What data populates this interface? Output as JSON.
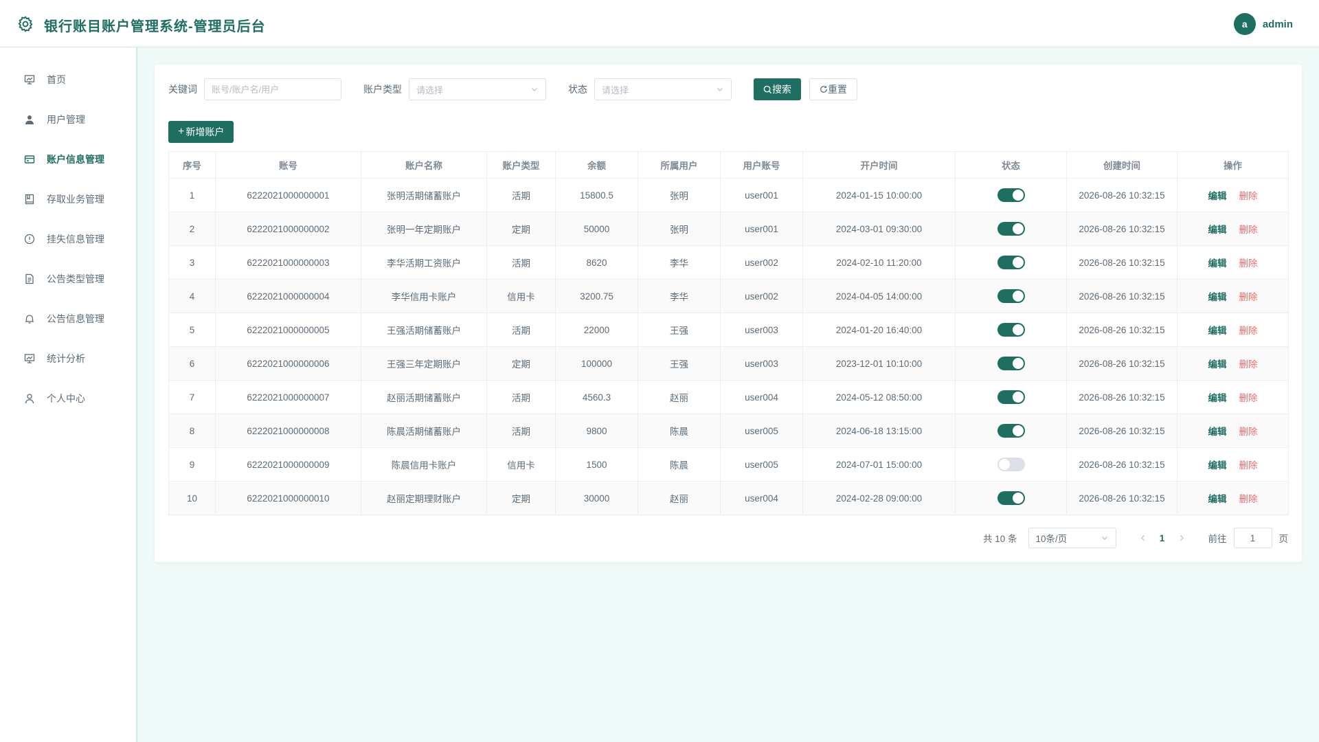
{
  "header": {
    "title": "银行账目账户管理系统-管理员后台",
    "avatar_letter": "a",
    "user_name": "admin",
    "logo_icon": "gear-icon"
  },
  "sidebar": {
    "items": [
      {
        "label": "首页",
        "icon": "home-icon",
        "active": false
      },
      {
        "label": "用户管理",
        "icon": "user-icon",
        "active": false
      },
      {
        "label": "账户信息管理",
        "icon": "card-icon",
        "active": true
      },
      {
        "label": "存取业务管理",
        "icon": "book-icon",
        "active": false
      },
      {
        "label": "挂失信息管理",
        "icon": "info-icon",
        "active": false
      },
      {
        "label": "公告类型管理",
        "icon": "document-icon",
        "active": false
      },
      {
        "label": "公告信息管理",
        "icon": "bell-icon",
        "active": false
      },
      {
        "label": "统计分析",
        "icon": "chart-icon",
        "active": false
      },
      {
        "label": "个人中心",
        "icon": "person-icon",
        "active": false
      }
    ]
  },
  "filters": {
    "keyword_label": "关键词",
    "keyword_placeholder": "账号/账户名/用户",
    "type_label": "账户类型",
    "type_placeholder": "请选择",
    "status_label": "状态",
    "status_placeholder": "请选择",
    "search_label": "搜索",
    "reset_label": "重置"
  },
  "add_button": "新增账户",
  "table": {
    "columns": [
      "序号",
      "账号",
      "账户名称",
      "账户类型",
      "余额",
      "所属用户",
      "用户账号",
      "开户时间",
      "状态",
      "创建时间",
      "操作"
    ],
    "edit_label": "编辑",
    "delete_label": "删除",
    "rows": [
      {
        "idx": "1",
        "account": "6222021000000001",
        "name": "张明活期储蓄账户",
        "type": "活期",
        "balance": "15800.5",
        "owner": "张明",
        "username": "user001",
        "opened": "2024-01-15 10:00:00",
        "status": true,
        "created": "2026-08-26 10:32:15"
      },
      {
        "idx": "2",
        "account": "6222021000000002",
        "name": "张明一年定期账户",
        "type": "定期",
        "balance": "50000",
        "owner": "张明",
        "username": "user001",
        "opened": "2024-03-01 09:30:00",
        "status": true,
        "created": "2026-08-26 10:32:15"
      },
      {
        "idx": "3",
        "account": "6222021000000003",
        "name": "李华活期工资账户",
        "type": "活期",
        "balance": "8620",
        "owner": "李华",
        "username": "user002",
        "opened": "2024-02-10 11:20:00",
        "status": true,
        "created": "2026-08-26 10:32:15"
      },
      {
        "idx": "4",
        "account": "6222021000000004",
        "name": "李华信用卡账户",
        "type": "信用卡",
        "balance": "3200.75",
        "owner": "李华",
        "username": "user002",
        "opened": "2024-04-05 14:00:00",
        "status": true,
        "created": "2026-08-26 10:32:15"
      },
      {
        "idx": "5",
        "account": "6222021000000005",
        "name": "王强活期储蓄账户",
        "type": "活期",
        "balance": "22000",
        "owner": "王强",
        "username": "user003",
        "opened": "2024-01-20 16:40:00",
        "status": true,
        "created": "2026-08-26 10:32:15"
      },
      {
        "idx": "6",
        "account": "6222021000000006",
        "name": "王强三年定期账户",
        "type": "定期",
        "balance": "100000",
        "owner": "王强",
        "username": "user003",
        "opened": "2023-12-01 10:10:00",
        "status": true,
        "created": "2026-08-26 10:32:15"
      },
      {
        "idx": "7",
        "account": "6222021000000007",
        "name": "赵丽活期储蓄账户",
        "type": "活期",
        "balance": "4560.3",
        "owner": "赵丽",
        "username": "user004",
        "opened": "2024-05-12 08:50:00",
        "status": true,
        "created": "2026-08-26 10:32:15"
      },
      {
        "idx": "8",
        "account": "6222021000000008",
        "name": "陈晨活期储蓄账户",
        "type": "活期",
        "balance": "9800",
        "owner": "陈晨",
        "username": "user005",
        "opened": "2024-06-18 13:15:00",
        "status": true,
        "created": "2026-08-26 10:32:15"
      },
      {
        "idx": "9",
        "account": "6222021000000009",
        "name": "陈晨信用卡账户",
        "type": "信用卡",
        "balance": "1500",
        "owner": "陈晨",
        "username": "user005",
        "opened": "2024-07-01 15:00:00",
        "status": false,
        "created": "2026-08-26 10:32:15"
      },
      {
        "idx": "10",
        "account": "6222021000000010",
        "name": "赵丽定期理财账户",
        "type": "定期",
        "balance": "30000",
        "owner": "赵丽",
        "username": "user004",
        "opened": "2024-02-28 09:00:00",
        "status": true,
        "created": "2026-08-26 10:32:15"
      }
    ]
  },
  "pagination": {
    "total_text": "共 10 条",
    "page_size": "10条/页",
    "current_page": "1",
    "goto_label": "前往",
    "goto_value": "1",
    "page_suffix": "页"
  },
  "colors": {
    "primary": "#1f6e62",
    "danger": "#f56c6c",
    "background": "#effaf8"
  }
}
